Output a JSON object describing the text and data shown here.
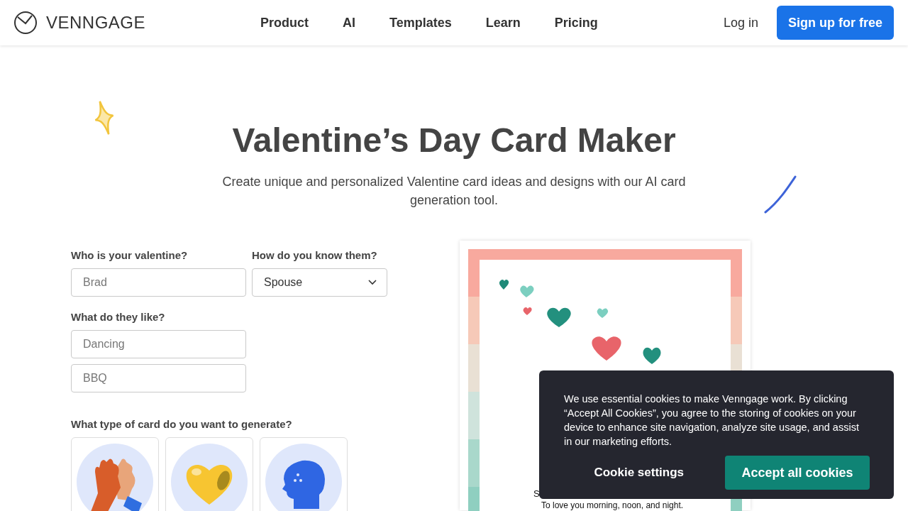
{
  "header": {
    "brand": "VENNGAGE",
    "nav": [
      "Product",
      "AI",
      "Templates",
      "Learn",
      "Pricing"
    ],
    "login": "Log in",
    "signup": "Sign up for free"
  },
  "hero": {
    "title": "Valentine’s Day Card Maker",
    "subtitle": "Create unique and personalized Valentine card ideas and designs with our AI card generation tool."
  },
  "form": {
    "name_label": "Who is your valentine?",
    "name_placeholder": "Brad",
    "relation_label": "How do you know them?",
    "relation_value": "Spouse",
    "likes_label": "What do they like?",
    "likes": [
      {
        "placeholder": "Dancing"
      },
      {
        "placeholder": "BBQ"
      }
    ],
    "type_label": "What type of card do you want to generate?",
    "card_types": [
      {
        "kind": "hands"
      },
      {
        "kind": "heart"
      },
      {
        "kind": "head"
      }
    ]
  },
  "preview": {
    "lines": [
      "S",
      "To love you morning, noon, and night."
    ]
  },
  "cookie_banner": {
    "text": "We use essential cookies to make Venngage work. By clicking “Accept All Cookies”, you agree to the storing of cookies on your device to enhance site navigation, analyze site usage, and assist in our marketing efforts.",
    "settings": "Cookie settings",
    "accept": "Accept all cookies"
  }
}
